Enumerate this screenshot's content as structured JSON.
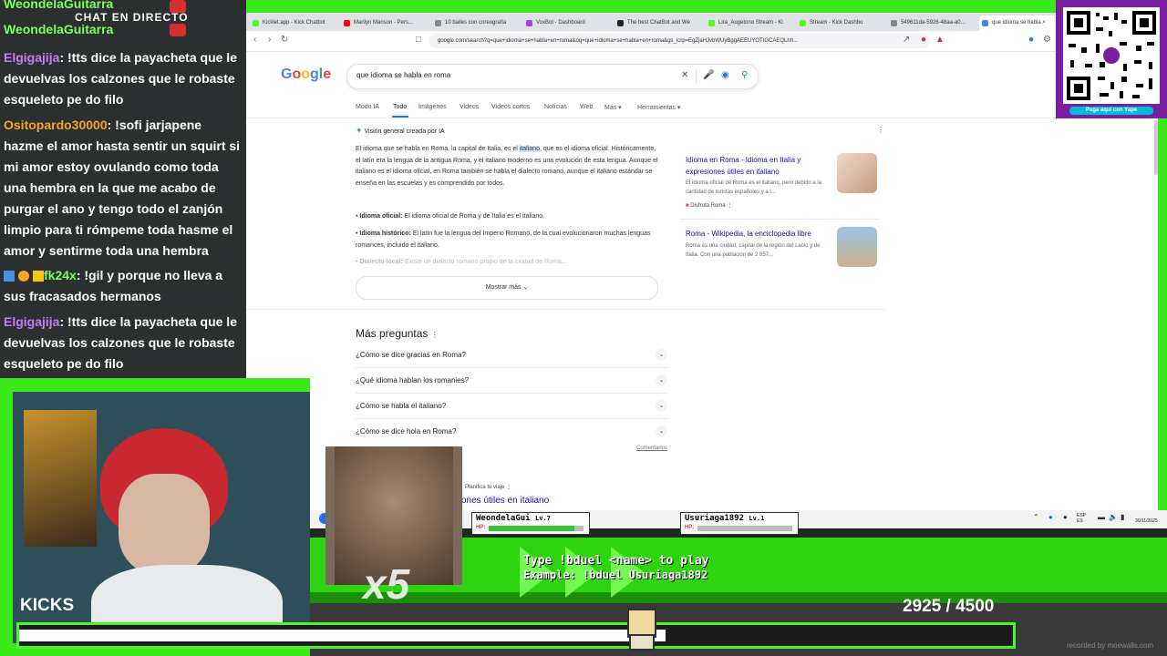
{
  "chat": {
    "header": "CHAT EN DIRECTO",
    "top_user1": "WeondelaGuitarra",
    "top_user2": "WeondelaGuitarra",
    "messages": [
      {
        "user": "Elgigajija",
        "text": ": !tts dice la payacheta que le devuelvas los calzones que le robaste esqueleto pe do filo",
        "color": "#c07ff7"
      },
      {
        "user": "Ositopardo30000",
        "text": ": !sofi jarjapene hazme el amor hasta sentir un squirt si mi amor estoy ovulando como toda una hembra en la que me acabo de purgar el ano y tengo todo el zanjón limpio para ti rómpeme toda hasme el amor y sentirme toda una hembra",
        "color": "#f5a623"
      },
      {
        "user": "fk24x",
        "text": ": !gil y porque no lleva a sus fracasados hermanos",
        "color": "#7dff5c"
      },
      {
        "user": "Elgigajija",
        "text": ": !tts dice la payacheta que le devuelvas los calzones que le robaste esqueleto pe do filo",
        "color": "#c07ff7"
      }
    ]
  },
  "browser": {
    "tabs": [
      {
        "label": "Kicklet.app - Kick Chatbot",
        "color": "#53fc18"
      },
      {
        "label": "Marilyn Manson - Pers...",
        "color": "#ff0000"
      },
      {
        "label": "10 bailes con coreografía",
        "color": "#888888"
      },
      {
        "label": "VoxBot - Dashboard",
        "color": "#a142f4"
      },
      {
        "label": "The best ChatBot and We",
        "color": "#222222"
      },
      {
        "label": "Lira_Augetono Stream - Ki",
        "color": "#53fc18"
      },
      {
        "label": "Stream - Kick Dashbo",
        "color": "#53fc18"
      },
      {
        "label": "549611da-5926-48aa-a0...",
        "color": "#888888"
      },
      {
        "label": "que idioma se habla ×",
        "color": "#4285f4"
      }
    ],
    "url": "google.com/search?q=que+idioma+se+habla+en+roma&oq=que+idioma+se+habla+en+roma&gs_lcrp=EgZjaHJvbWUyBggAEEUYOTIGCAEQLhh..."
  },
  "google": {
    "logo": "Google",
    "query": "que idioma se habla en roma",
    "filters": [
      "Modo IA",
      "Todo",
      "Imágenes",
      "Videos",
      "Videos cortos",
      "Noticias",
      "Web",
      "Más ▾",
      "Herramientas ▾"
    ],
    "ai_header": "Visión general creada por IA",
    "ai_para_before": "El idioma que se habla en Roma, la capital de Italia, es el ",
    "ai_para_highlight": "italiano",
    "ai_para_after": ", que es el idioma oficial. Históricamente, el latín era la lengua de la antigua Roma, y el italiano moderno es una evolución de esta lengua. Aunque el italiano es el idioma oficial, en Roma también se habla el dialecto romano, aunque el italiano estándar se enseña en las escuelas y es comprendido por todos.",
    "bullets": [
      {
        "label": "Idioma oficial:",
        "text": " El idioma oficial de Roma y de Italia es el italiano."
      },
      {
        "label": "Idioma histórico:",
        "text": " El latín fue la lengua del Imperio Romano, de la cual evolucionaron muchas lenguas romances, incluido el italiano."
      },
      {
        "label": "Dialecto local:",
        "text": " Existe un dialecto romano propio de la ciudad de Roma..."
      }
    ],
    "show_more": "Mostrar más",
    "cards": [
      {
        "title": "Idioma en Roma - Idioma en Italia y expresiones útiles en italiano",
        "snippet": "El idioma oficial de Roma es el italiano, pero debido a la cantidad de turistas españoles y a l...",
        "source": "Disfruta Roma"
      },
      {
        "title": "Roma - Wikipedia, la enciclopedia libre",
        "snippet": "Roma es una ciudad, capital de la región del Lacio y de Italia. Con una población de 2 857...",
        "source": ""
      }
    ],
    "paa_title": "Más preguntas",
    "paa": [
      "¿Cómo se dice gracias en Roma?",
      "¿Qué idioma hablan los romanies?",
      "¿Cómo se habla el italiano?",
      "¿Cómo se dice hola en Roma?"
    ],
    "feedback": "Comentarios",
    "plan_trip": "Planifica tu viaje",
    "snippet_link": "ones útiles en italiano"
  },
  "taskbar": {
    "lang": "ESP\nES",
    "time": "\n30/11/2025"
  },
  "duel": {
    "player1": {
      "name": "WeondelaGui",
      "level": "Lv.7",
      "hp_fraction": 0.9
    },
    "player2": {
      "name": "Usuriaga1892",
      "level": "Lv.1",
      "hp_fraction": 0.0
    },
    "hp_label": "HP:",
    "title": "Type !bduel <name> to play",
    "example": "Example: !bduel Usuriaga1892"
  },
  "goal": {
    "label": "KICKS",
    "current": "2925",
    "target": "4500",
    "display": "2925  / 4500",
    "fraction": 0.65
  },
  "alert": {
    "multiplier": "x5"
  },
  "qr": {
    "caption": "Paga aquí con Yape",
    "brand": "yape"
  },
  "watermark": "recorded by moewalls.com",
  "colors": {
    "kick_green": "#3be81a",
    "google_blue": "#1a73e8",
    "yape_purple": "#7b1fa2"
  }
}
